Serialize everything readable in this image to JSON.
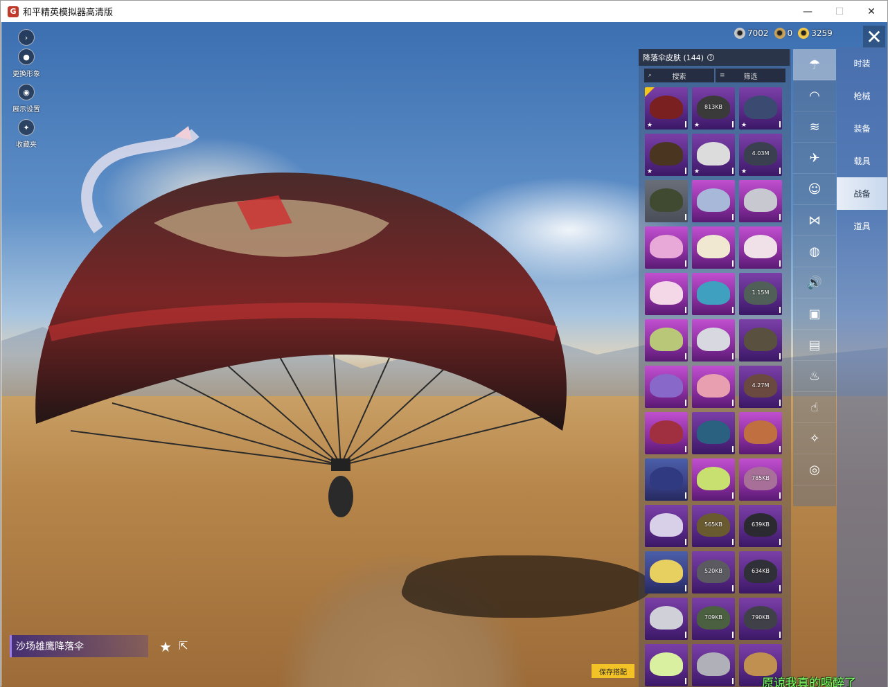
{
  "window": {
    "title": "和平精英模拟器高清版",
    "minimize": "—",
    "maximize": "☐",
    "close": "✕"
  },
  "left_tools": [
    {
      "icon": "play-arrow-icon",
      "glyph": "›",
      "label": ""
    },
    {
      "icon": "avatar-icon",
      "glyph": "●",
      "label": "更换形象"
    },
    {
      "icon": "eye-icon",
      "glyph": "◉",
      "label": "展示设置"
    },
    {
      "icon": "badge-icon",
      "glyph": "✦",
      "label": "收藏夹"
    }
  ],
  "currency": [
    {
      "icon": "silver-coin-icon",
      "value": "7002",
      "color": "#c8c8c8"
    },
    {
      "icon": "bronze-coin-icon",
      "value": "0",
      "color": "#c9a35a"
    },
    {
      "icon": "gold-coin-icon",
      "value": "3259",
      "color": "#f2c94c"
    }
  ],
  "panel": {
    "title": "降落伞皮肤 (144)",
    "search_label": "搜索",
    "filter_label": "筛选"
  },
  "tiles": [
    {
      "bg": "purple",
      "canopy": "#7a2020",
      "size": "",
      "star": true,
      "check": true
    },
    {
      "bg": "purple",
      "canopy": "#3a3a3a",
      "size": "813KB",
      "star": true,
      "check": false
    },
    {
      "bg": "purple",
      "canopy": "#3a4a70",
      "size": "",
      "star": true,
      "check": false
    },
    {
      "bg": "purple",
      "canopy": "#4a3520",
      "size": "",
      "star": true,
      "check": false
    },
    {
      "bg": "purple",
      "canopy": "#dcdcdc",
      "size": "",
      "star": true,
      "check": false
    },
    {
      "bg": "purple",
      "canopy": "#3a4050",
      "size": "4.03M",
      "star": true,
      "check": false
    },
    {
      "bg": "grey",
      "canopy": "#3f4a30",
      "size": "",
      "star": false,
      "check": false
    },
    {
      "bg": "pink",
      "canopy": "#a8b8d8",
      "size": "",
      "star": false,
      "check": false
    },
    {
      "bg": "pink",
      "canopy": "#c8c8d0",
      "size": "",
      "star": false,
      "check": false
    },
    {
      "bg": "pink",
      "canopy": "#e8a8d8",
      "size": "",
      "star": false,
      "check": false
    },
    {
      "bg": "pink",
      "canopy": "#f0e8d0",
      "size": "",
      "star": false,
      "check": false
    },
    {
      "bg": "pink",
      "canopy": "#f0e0e8",
      "size": "",
      "star": false,
      "check": false
    },
    {
      "bg": "pink",
      "canopy": "#f4d8e8",
      "size": "",
      "star": false,
      "check": false
    },
    {
      "bg": "pink",
      "canopy": "#40a0c0",
      "size": "",
      "star": false,
      "check": false
    },
    {
      "bg": "purple",
      "canopy": "#506058",
      "size": "1.15M",
      "star": false,
      "check": false
    },
    {
      "bg": "pink",
      "canopy": "#b8c878",
      "size": "",
      "star": false,
      "check": false
    },
    {
      "bg": "pink",
      "canopy": "#d8d8e0",
      "size": "",
      "star": false,
      "check": false
    },
    {
      "bg": "purple",
      "canopy": "#5a5040",
      "size": "",
      "star": false,
      "check": false
    },
    {
      "bg": "pink",
      "canopy": "#8868c8",
      "size": "",
      "star": false,
      "check": false
    },
    {
      "bg": "pink",
      "canopy": "#e8a0b0",
      "size": "",
      "star": false,
      "check": false
    },
    {
      "bg": "purple",
      "canopy": "#6a4a40",
      "size": "4.27M",
      "star": false,
      "check": false
    },
    {
      "bg": "pink",
      "canopy": "#a03040",
      "size": "",
      "star": false,
      "check": false
    },
    {
      "bg": "purple",
      "canopy": "#2a6080",
      "size": "",
      "star": false,
      "check": false
    },
    {
      "bg": "pink",
      "canopy": "#c07040",
      "size": "",
      "star": false,
      "check": false
    },
    {
      "bg": "blue",
      "canopy": "#303a80",
      "size": "",
      "star": false,
      "check": false
    },
    {
      "bg": "pink",
      "canopy": "#c8e070",
      "size": "",
      "star": false,
      "check": false
    },
    {
      "bg": "pink",
      "canopy": "#a87098",
      "size": "785KB",
      "star": false,
      "check": false
    },
    {
      "bg": "purple",
      "canopy": "#d8d0e8",
      "size": "",
      "star": false,
      "check": false
    },
    {
      "bg": "purple",
      "canopy": "#6a5a30",
      "size": "565KB",
      "star": false,
      "check": false
    },
    {
      "bg": "purple",
      "canopy": "#2a2a30",
      "size": "639KB",
      "star": false,
      "check": false
    },
    {
      "bg": "blue",
      "canopy": "#e8d060",
      "size": "",
      "star": false,
      "check": false
    },
    {
      "bg": "purple",
      "canopy": "#5a5a60",
      "size": "520KB",
      "star": false,
      "check": false
    },
    {
      "bg": "purple",
      "canopy": "#303038",
      "size": "634KB",
      "star": false,
      "check": false
    },
    {
      "bg": "purple",
      "canopy": "#d0d0d8",
      "size": "",
      "star": false,
      "check": false
    },
    {
      "bg": "purple",
      "canopy": "#4a6040",
      "size": "709KB",
      "star": false,
      "check": false
    },
    {
      "bg": "purple",
      "canopy": "#404048",
      "size": "790KB",
      "star": false,
      "check": false
    },
    {
      "bg": "purple",
      "canopy": "#d8f0a0",
      "size": "",
      "star": false,
      "check": false
    },
    {
      "bg": "purple",
      "canopy": "#b0b0b8",
      "size": "",
      "star": false,
      "check": false
    },
    {
      "bg": "purple",
      "canopy": "#c09050",
      "size": "",
      "star": false,
      "check": false
    }
  ],
  "categories": [
    {
      "icon": "parachute-icon",
      "glyph": "☂",
      "active": true
    },
    {
      "icon": "wing-icon",
      "glyph": "◠",
      "active": false
    },
    {
      "icon": "trail-icon",
      "glyph": "≋",
      "active": false
    },
    {
      "icon": "plane-icon",
      "glyph": "✈",
      "active": false
    },
    {
      "icon": "emote-icon",
      "glyph": "☺",
      "active": false
    },
    {
      "icon": "drone-icon",
      "glyph": "⋈",
      "active": false
    },
    {
      "icon": "pet-icon",
      "glyph": "◍",
      "active": false
    },
    {
      "icon": "voice-icon",
      "glyph": "🔊",
      "active": false
    },
    {
      "icon": "box-icon",
      "glyph": "▣",
      "active": false
    },
    {
      "icon": "photo-icon",
      "glyph": "▤",
      "active": false
    },
    {
      "icon": "spray-icon",
      "glyph": "♨",
      "active": false
    },
    {
      "icon": "hand-icon",
      "glyph": "☝",
      "active": false
    },
    {
      "icon": "wand-icon",
      "glyph": "✧",
      "active": false
    },
    {
      "icon": "saucer-icon",
      "glyph": "◎",
      "active": false
    }
  ],
  "tabs": [
    {
      "label": "时装",
      "active": false
    },
    {
      "label": "枪械",
      "active": false
    },
    {
      "label": "装备",
      "active": false
    },
    {
      "label": "载具",
      "active": false
    },
    {
      "label": "战备",
      "active": true
    },
    {
      "label": "道具",
      "active": false
    }
  ],
  "item": {
    "name": "沙场雄鹰降落伞"
  },
  "save_label": "保存搭配",
  "watermark": "原谅我真的喝醉了"
}
